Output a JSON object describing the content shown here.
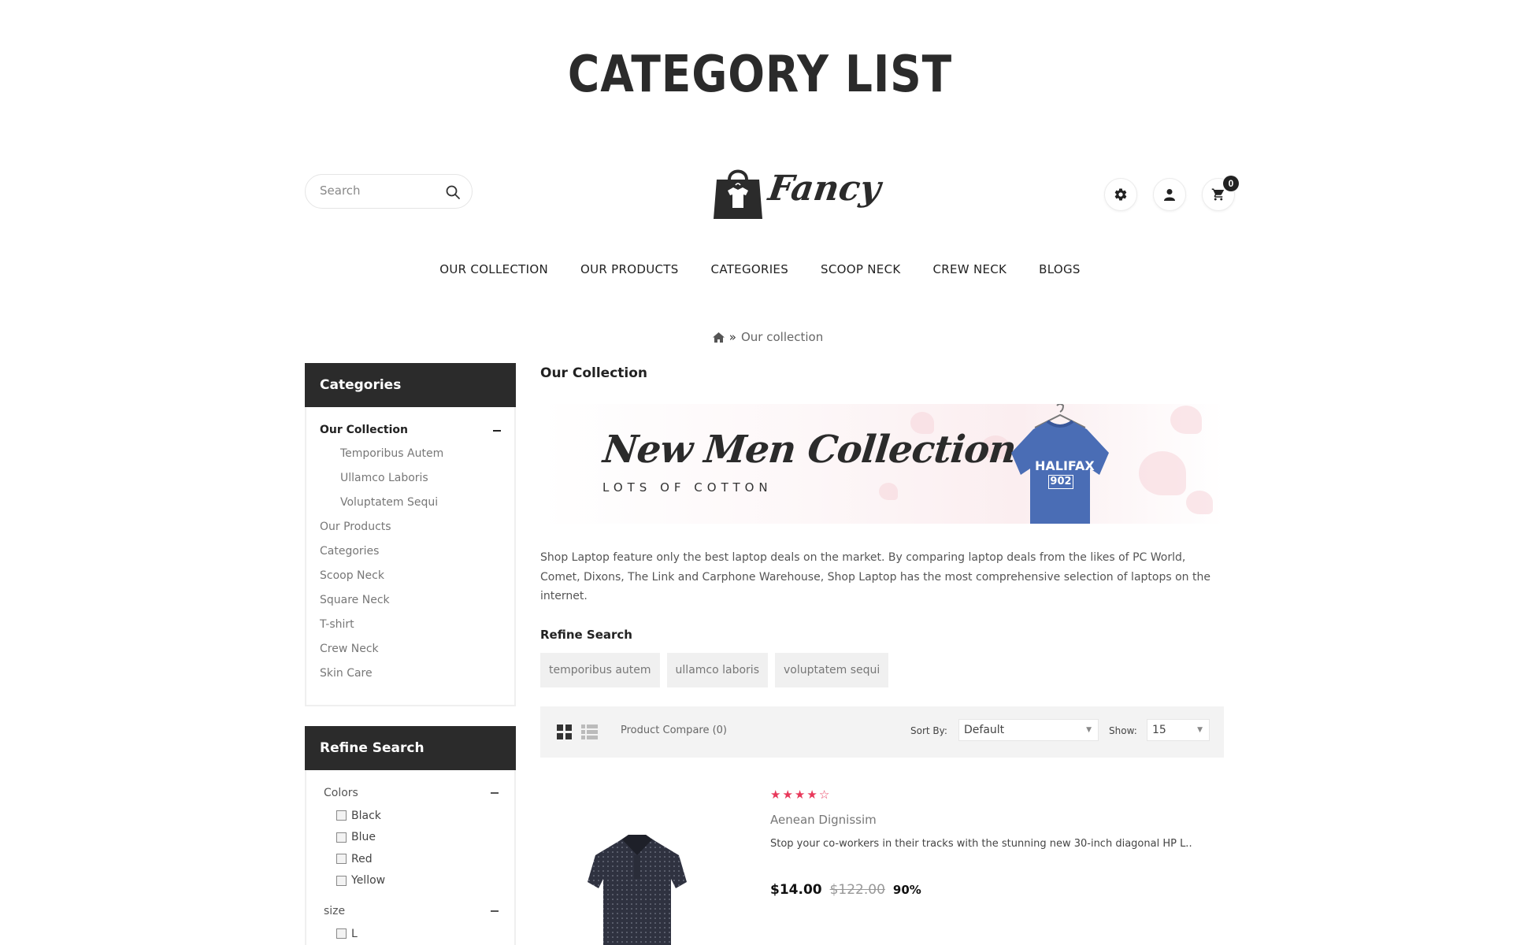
{
  "page_heading": "CATEGORY LIST",
  "header": {
    "search_placeholder": "Search",
    "logo_text": "Fancy",
    "cart_count": "0"
  },
  "nav": [
    "OUR COLLECTION",
    "OUR PRODUCTS",
    "CATEGORIES",
    "SCOOP NECK",
    "CREW NECK",
    "BLOGS"
  ],
  "breadcrumb": {
    "current": "Our collection"
  },
  "sidebar": {
    "categories_title": "Categories",
    "categories": {
      "active": "Our Collection",
      "sub": [
        "Temporibus Autem",
        "Ullamco Laboris",
        "Voluptatem Sequi"
      ],
      "others": [
        "Our Products",
        "Categories",
        "Scoop Neck",
        "Square Neck",
        "T-shirt",
        "Crew Neck",
        "Skin Care"
      ]
    },
    "refine_title": "Refine Search",
    "colors_title": "Colors",
    "colors": [
      "Black",
      "Blue",
      "Red",
      "Yellow"
    ],
    "size_title": "size",
    "sizes": [
      "L"
    ]
  },
  "main": {
    "title": "Our Collection",
    "banner": {
      "title": "New Men Collection",
      "subtitle": "LOTS OF COTTON",
      "shirt_text": "HALIFAX",
      "shirt_number": "902"
    },
    "description": "Shop Laptop feature only the best laptop deals on the market. By comparing laptop deals from the likes of PC World, Comet, Dixons, The Link and Carphone Warehouse, Shop Laptop has the most comprehensive selection of laptops on the internet.",
    "refine_label": "Refine Search",
    "tags": [
      "temporibus autem",
      "ullamco laboris",
      "voluptatem sequi"
    ],
    "toolbar": {
      "compare": "Product Compare (0)",
      "sort_label": "Sort By:",
      "sort_value": "Default",
      "show_label": "Show:",
      "show_value": "15"
    },
    "product": {
      "rating": 4,
      "rating_max": 5,
      "name": "Aenean Dignissim",
      "description": "Stop your co-workers in their tracks with the stunning new 30-inch diagonal HP L..",
      "price": "$14.00",
      "old_price": "$122.00",
      "discount": "90%"
    }
  }
}
